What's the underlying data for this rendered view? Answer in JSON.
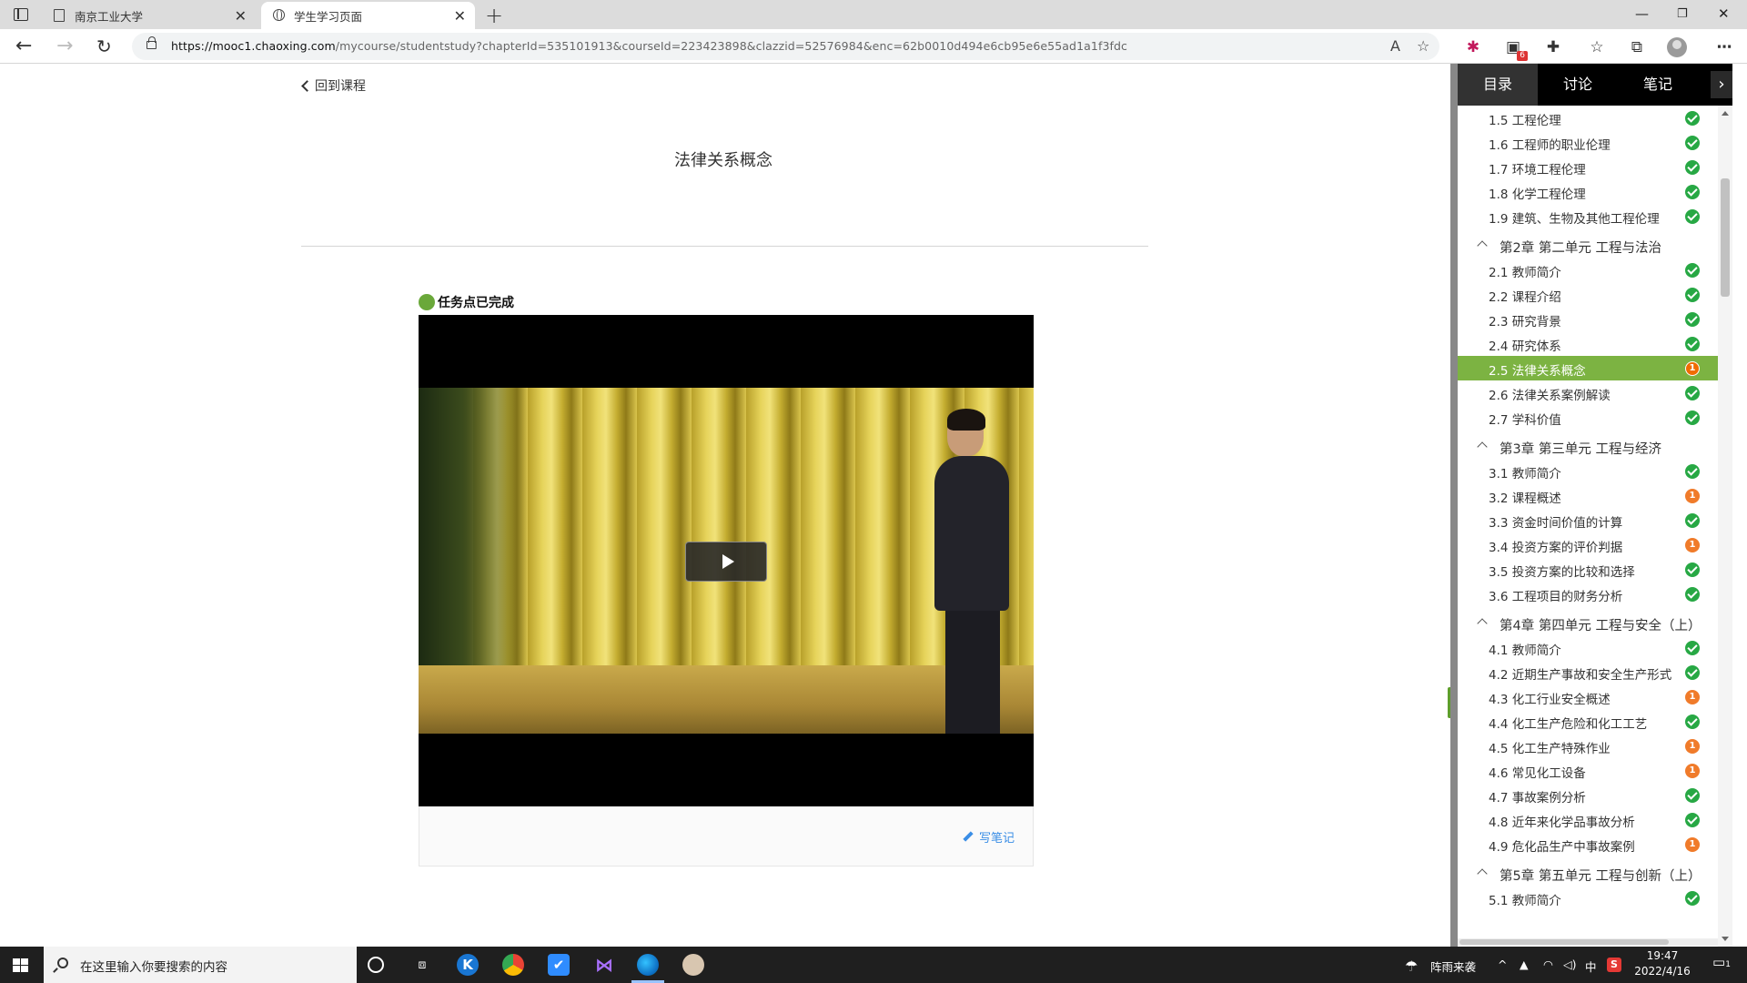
{
  "browser": {
    "tabs": [
      {
        "title": "南京工业大学",
        "icon": "document-icon"
      },
      {
        "title": "学生学习页面",
        "icon": "globe-icon"
      }
    ],
    "url_host": "https://mooc1.chaoxing.com",
    "url_rest": "/mycourse/studentstudy?chapterId=535101913&courseId=223423898&clazzid=52576984&enc=62b0010d494e6cb95e6e55ad1a1f3fdc",
    "extension_badge": "6"
  },
  "page": {
    "back_label": "回到课程",
    "title": "法律关系概念",
    "task_status": "任务点已完成",
    "write_note": "写笔记"
  },
  "panel": {
    "tabs": [
      "目录",
      "讨论",
      "笔记"
    ],
    "active_tab": "目录",
    "toc": [
      {
        "kind": "item",
        "label": "1.5 工程伦理",
        "status": "done"
      },
      {
        "kind": "item",
        "label": "1.6 工程师的职业伦理",
        "status": "done"
      },
      {
        "kind": "item",
        "label": "1.7 环境工程伦理",
        "status": "done"
      },
      {
        "kind": "item",
        "label": "1.8 化学工程伦理",
        "status": "done"
      },
      {
        "kind": "item",
        "label": "1.9 建筑、生物及其他工程伦理",
        "status": "done"
      },
      {
        "kind": "chapter",
        "label": "第2章 第二单元 工程与法治"
      },
      {
        "kind": "item",
        "label": "2.1 教师简介",
        "status": "done"
      },
      {
        "kind": "item",
        "label": "2.2 课程介绍",
        "status": "done"
      },
      {
        "kind": "item",
        "label": "2.3 研究背景",
        "status": "done"
      },
      {
        "kind": "item",
        "label": "2.4 研究体系",
        "status": "done"
      },
      {
        "kind": "item",
        "label": "2.5 法律关系概念",
        "status": "pending",
        "count": "1",
        "current": true
      },
      {
        "kind": "item",
        "label": "2.6 法律关系案例解读",
        "status": "done"
      },
      {
        "kind": "item",
        "label": "2.7 学科价值",
        "status": "done"
      },
      {
        "kind": "chapter",
        "label": "第3章 第三单元 工程与经济"
      },
      {
        "kind": "item",
        "label": "3.1 教师简介",
        "status": "done"
      },
      {
        "kind": "item",
        "label": "3.2 课程概述",
        "status": "pending",
        "count": "1"
      },
      {
        "kind": "item",
        "label": "3.3 资金时间价值的计算",
        "status": "done"
      },
      {
        "kind": "item",
        "label": "3.4 投资方案的评价判据",
        "status": "pending",
        "count": "1"
      },
      {
        "kind": "item",
        "label": "3.5 投资方案的比较和选择",
        "status": "done"
      },
      {
        "kind": "item",
        "label": "3.6 工程项目的财务分析",
        "status": "done"
      },
      {
        "kind": "chapter",
        "label": "第4章 第四单元 工程与安全（上）"
      },
      {
        "kind": "item",
        "label": "4.1 教师简介",
        "status": "done"
      },
      {
        "kind": "item",
        "label": "4.2 近期生产事故和安全生产形式",
        "status": "done"
      },
      {
        "kind": "item",
        "label": "4.3 化工行业安全概述",
        "status": "pending",
        "count": "1"
      },
      {
        "kind": "item",
        "label": "4.4 化工生产危险和化工工艺",
        "status": "done"
      },
      {
        "kind": "item",
        "label": "4.5 化工生产特殊作业",
        "status": "pending",
        "count": "1"
      },
      {
        "kind": "item",
        "label": "4.6 常见化工设备",
        "status": "pending",
        "count": "1"
      },
      {
        "kind": "item",
        "label": "4.7 事故案例分析",
        "status": "done"
      },
      {
        "kind": "item",
        "label": "4.8 近年来化学品事故分析",
        "status": "done"
      },
      {
        "kind": "item",
        "label": "4.9 危化品生产中事故案例",
        "status": "pending",
        "count": "1"
      },
      {
        "kind": "chapter",
        "label": "第5章 第五单元 工程与创新（上）"
      },
      {
        "kind": "item",
        "label": "5.1 教师简介",
        "status": "done"
      }
    ]
  },
  "taskbar": {
    "search_placeholder": "在这里输入你要搜索的内容",
    "weather": "阵雨来袭",
    "ime": "中",
    "time": "19:47",
    "date": "2022/4/16",
    "notification_count": "1"
  },
  "colors": {
    "accent_green": "#7cb342",
    "done_green": "#27a844",
    "pending_orange": "#f07b2a",
    "link_blue": "#3a8ee6"
  }
}
